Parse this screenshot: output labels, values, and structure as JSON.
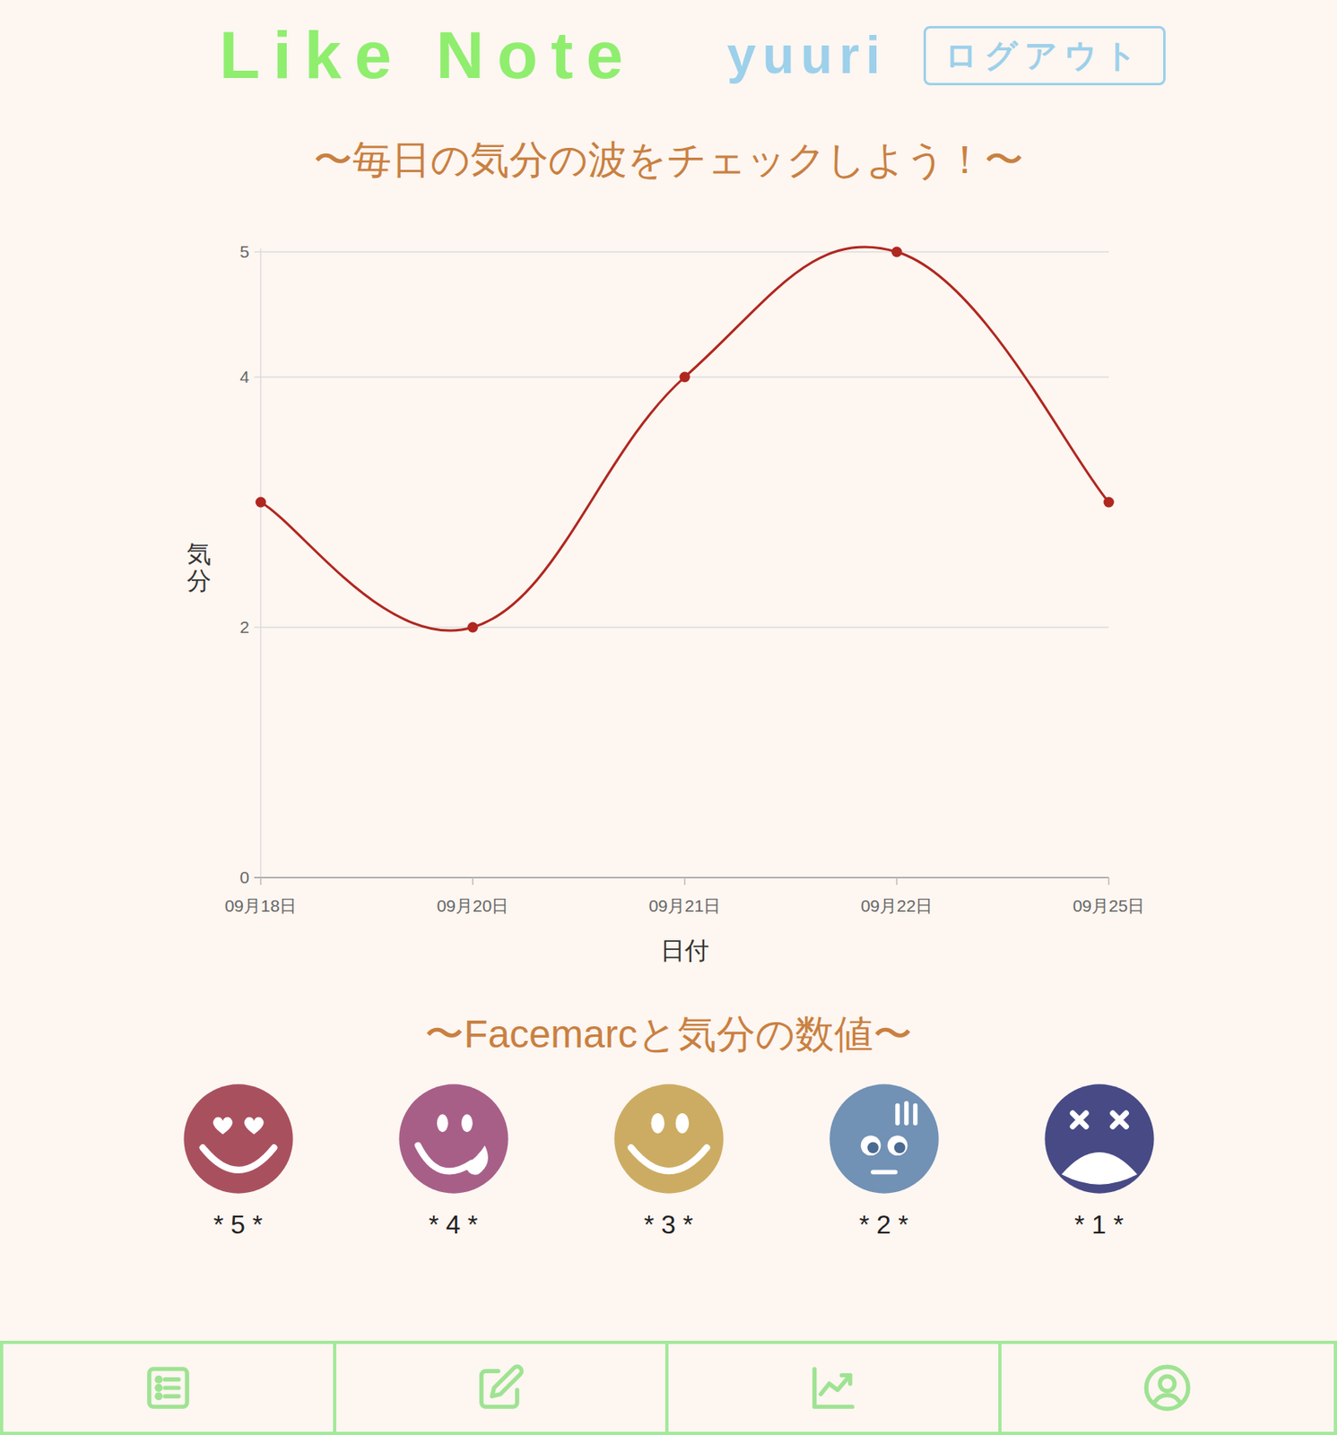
{
  "header": {
    "logo": "Like Note",
    "user": "yuuri",
    "logout": "ログアウト"
  },
  "chart": {
    "title": "〜毎日の気分の波をチェックしよう！〜",
    "y_axis_label": "気分",
    "x_axis_label": "日付",
    "y_ticks": [
      "5",
      "4",
      "2",
      "0"
    ],
    "dates": [
      "09月18日",
      "09月20日",
      "09月21日",
      "09月22日",
      "09月25日"
    ],
    "series": [
      {
        "values": [
          3,
          2,
          4,
          5,
          3
        ]
      }
    ]
  },
  "legend": {
    "title": "〜Facemarcと気分の数値〜",
    "faces": [
      {
        "label": "* 5 *",
        "kind": "love",
        "color": "#a9505e"
      },
      {
        "label": "* 4 *",
        "kind": "tongue",
        "color": "#a75f88"
      },
      {
        "label": "* 3 *",
        "kind": "smile",
        "color": "#ccac62"
      },
      {
        "label": "* 2 *",
        "kind": "nervous",
        "color": "#7191b5"
      },
      {
        "label": "* 1 *",
        "kind": "dizzy",
        "color": "#474a85"
      }
    ]
  }
}
